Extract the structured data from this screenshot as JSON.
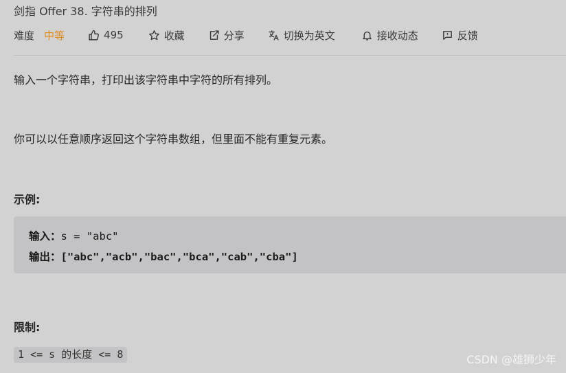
{
  "problem": {
    "title": "剑指 Offer 38. 字符串的排列"
  },
  "meta": {
    "difficulty_label": "难度",
    "difficulty_value": "中等",
    "likes": "495",
    "favorite": "收藏",
    "share": "分享",
    "switch_lang": "切换为英文",
    "notifications": "接收动态",
    "feedback": "反馈",
    "difficulty_color": "#e08a1e"
  },
  "description": {
    "p1": "输入一个字符串，打印出该字符串中字符的所有排列。",
    "p2": "你可以以任意顺序返回这个字符串数组，但里面不能有重复元素。"
  },
  "example": {
    "heading": "示例:",
    "input_label": "输入：",
    "input_value": "s = \"abc\"",
    "output_label": "输出：",
    "output_value": "[\"abc\",\"acb\",\"bac\",\"bca\",\"cab\",\"cba\"]"
  },
  "constraints": {
    "heading": "限制:",
    "item": "1 <= s 的长度 <= 8"
  },
  "watermark": "CSDN @雄狮少年"
}
